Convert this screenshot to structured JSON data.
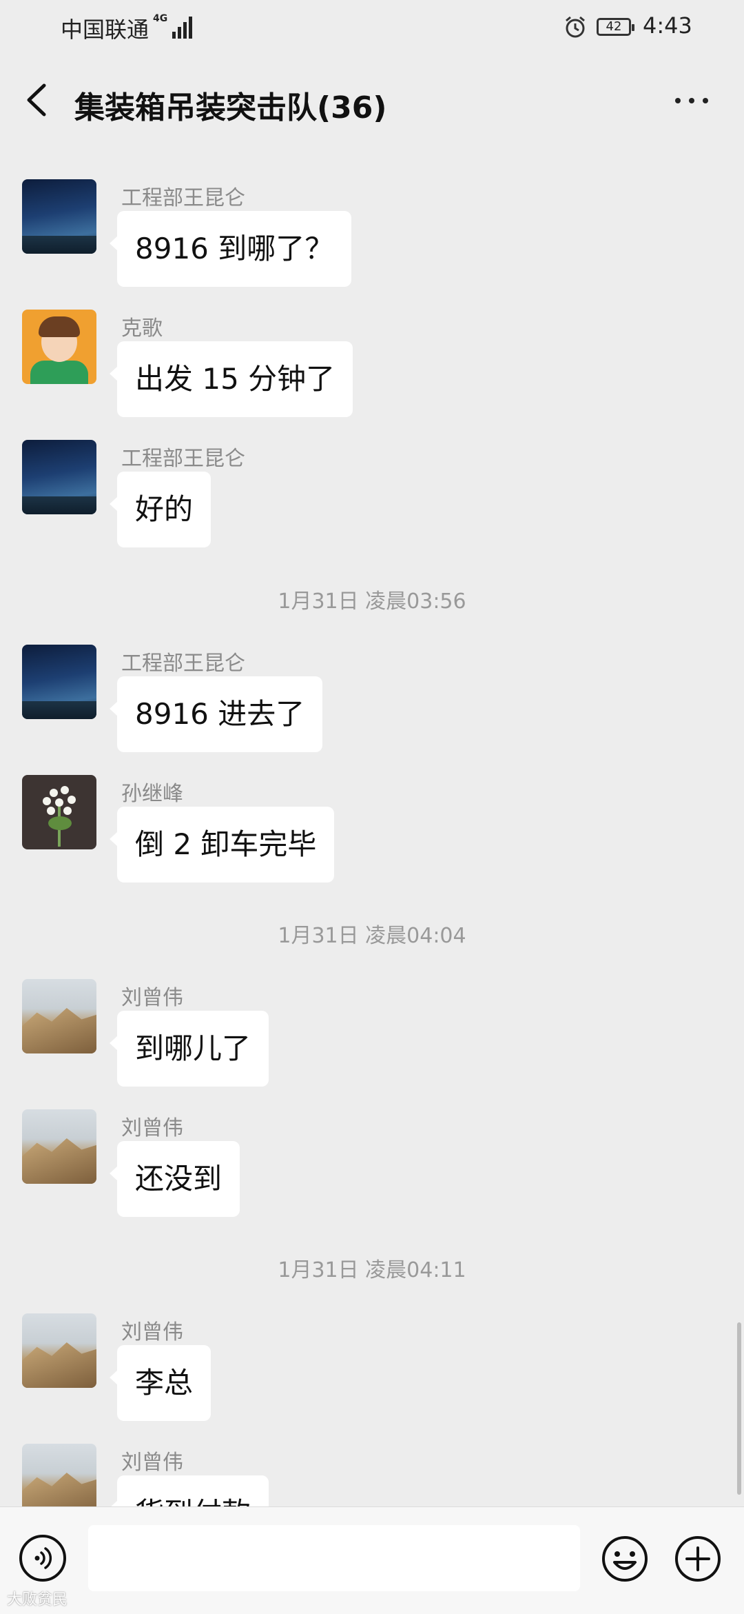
{
  "status_bar": {
    "carrier": "中国联通",
    "network": "4G",
    "battery": "42",
    "time": "4:43"
  },
  "header": {
    "title": "集装箱吊装突击队(36)"
  },
  "messages": [
    {
      "type": "message",
      "sender": "工程部王昆仑",
      "text": "8916 到哪了？",
      "avatar": "night-sky"
    },
    {
      "type": "message",
      "sender": "克歌",
      "text": "出发 15 分钟了",
      "avatar": "child"
    },
    {
      "type": "message",
      "sender": "工程部王昆仑",
      "text": "好的",
      "avatar": "night-sky"
    },
    {
      "type": "timestamp",
      "text": "1月31日 凌晨03:56"
    },
    {
      "type": "message",
      "sender": "工程部王昆仑",
      "text": "8916 进去了",
      "avatar": "night-sky"
    },
    {
      "type": "message",
      "sender": "孙继峰",
      "text": "倒 2 卸车完毕",
      "avatar": "flower"
    },
    {
      "type": "timestamp",
      "text": "1月31日 凌晨04:04"
    },
    {
      "type": "message",
      "sender": "刘曾伟",
      "text": "到哪儿了",
      "avatar": "mountain"
    },
    {
      "type": "message",
      "sender": "刘曾伟",
      "text": "还没到",
      "avatar": "mountain"
    },
    {
      "type": "timestamp",
      "text": "1月31日 凌晨04:11"
    },
    {
      "type": "message",
      "sender": "刘曾伟",
      "text": "李总",
      "avatar": "mountain"
    },
    {
      "type": "message",
      "sender": "刘曾伟",
      "text": "货到付款",
      "avatar": "mountain"
    }
  ],
  "input_bar": {
    "voice_icon": "voice-icon",
    "emoji_icon": "emoji-icon",
    "plus_icon": "plus-icon",
    "text_value": ""
  },
  "watermark": "大败贫民"
}
